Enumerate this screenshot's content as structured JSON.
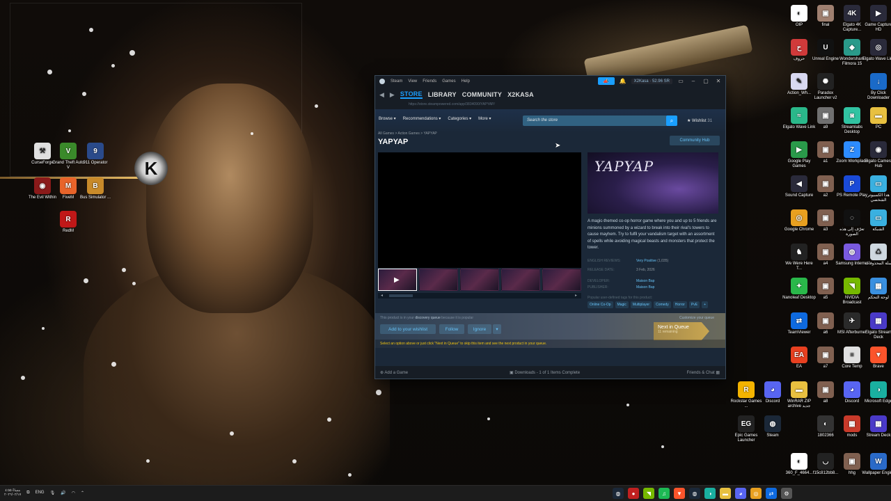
{
  "desktop": {
    "left_icons": [
      {
        "label": "CurseForge",
        "icon": "curseforge-icon",
        "color": "#e0e0e0",
        "glyph": "⚒"
      },
      {
        "label": "Grand Theft Auto V",
        "icon": "gta-icon",
        "color": "#3a8a2a",
        "glyph": "V"
      },
      {
        "label": "911 Operator",
        "icon": "operator-icon",
        "color": "#2a4a8a",
        "glyph": "9"
      },
      {
        "label": "The Evil Within",
        "icon": "evil-within-icon",
        "color": "#8a1a1a",
        "glyph": "◉"
      },
      {
        "label": "FiveM",
        "icon": "fivem-icon",
        "color": "#e8642a",
        "glyph": "M"
      },
      {
        "label": "Bus Simulator ...",
        "icon": "bus-icon",
        "color": "#c88a2a",
        "glyph": "B"
      },
      {
        "label": "RedM",
        "icon": "redm-icon",
        "color": "#c01818",
        "glyph": "R"
      }
    ],
    "right_icons": [
      {
        "label": "OIP",
        "icon": "oip-icon",
        "color": "#ffffff",
        "glyph": "◐"
      },
      {
        "label": "final",
        "icon": "image-icon",
        "color": "#a08070",
        "glyph": "▣"
      },
      {
        "label": "Elgato 4K Capture...",
        "icon": "elgato-4k-icon",
        "color": "#2a2a3a",
        "glyph": "4K"
      },
      {
        "label": "Game Capture HD",
        "icon": "game-capture-icon",
        "color": "#2a2a3a",
        "glyph": "▶"
      },
      {
        "label": "حروف",
        "icon": "letters-icon",
        "color": "#d03a3a",
        "glyph": "ح"
      },
      {
        "label": "Unreal Engine",
        "icon": "unreal-icon",
        "color": "#111111",
        "glyph": "U"
      },
      {
        "label": "Wondershare Filmora 15",
        "icon": "filmora-icon",
        "color": "#2a9a8a",
        "glyph": "◆"
      },
      {
        "label": "Elgato Wave Link",
        "icon": "wave-link-icon",
        "color": "#2a2a3a",
        "glyph": "◎"
      },
      {
        "label": "Action_Wh...",
        "icon": "file-icon",
        "color": "#d8d8f0",
        "glyph": "✎"
      },
      {
        "label": "Paradox Launcher v2",
        "icon": "paradox-icon",
        "color": "#222222",
        "glyph": "✺"
      },
      {
        "label": "By Click Downloader",
        "icon": "byclick-icon",
        "color": "#1a6ac8",
        "glyph": "↓"
      },
      {
        "label": "Elgato Wave Link",
        "icon": "wave-link-icon",
        "color": "#2ab88a",
        "glyph": "≈"
      },
      {
        "label": "a9",
        "icon": "image-icon",
        "color": "#707070",
        "glyph": "▣"
      },
      {
        "label": "Streamlabs Desktop",
        "icon": "streamlabs-icon",
        "color": "#31c3a2",
        "glyph": "◙"
      },
      {
        "label": "PC",
        "icon": "folder-icon",
        "color": "#e8c040",
        "glyph": "▬"
      },
      {
        "label": "Google Play Games",
        "icon": "play-games-icon",
        "color": "#2a9a4a",
        "glyph": "▶"
      },
      {
        "label": "a1",
        "icon": "image-icon",
        "color": "#806050",
        "glyph": "▣"
      },
      {
        "label": "Zoom Workplace",
        "icon": "zoom-icon",
        "color": "#2d8cff",
        "glyph": "Z"
      },
      {
        "label": "Elgato Camera Hub",
        "icon": "camera-hub-icon",
        "color": "#2a2a3a",
        "glyph": "◉"
      },
      {
        "label": "Sound Capture",
        "icon": "sound-capture-icon",
        "color": "#2a2a3a",
        "glyph": "◀"
      },
      {
        "label": "a2",
        "icon": "image-icon",
        "color": "#806050",
        "glyph": "▣"
      },
      {
        "label": "PS Remote Play",
        "icon": "ps-remote-icon",
        "color": "#1a4ad8",
        "glyph": "P"
      },
      {
        "label": "هذا الكمبيوتر الشخصي",
        "icon": "this-pc-icon",
        "color": "#3ab0e0",
        "glyph": "▭"
      },
      {
        "label": "Google Chrome",
        "icon": "chrome-icon",
        "color": "#e8a020",
        "glyph": "◎"
      },
      {
        "label": "a3",
        "icon": "image-icon",
        "color": "#806050",
        "glyph": "▣"
      },
      {
        "label": "تعرّف إلى هذه الصورة",
        "icon": "learn-icon",
        "color": "#111111",
        "glyph": "◌"
      },
      {
        "label": "الشبكة",
        "icon": "network-icon",
        "color": "#3ab0e0",
        "glyph": "▭"
      },
      {
        "label": "We Were Here T...",
        "icon": "we-were-here-icon",
        "color": "#222222",
        "glyph": "♞"
      },
      {
        "label": "a4",
        "icon": "image-icon",
        "color": "#806050",
        "glyph": "▣"
      },
      {
        "label": "Samsung Internet",
        "icon": "samsung-internet-icon",
        "color": "#7a5ae0",
        "glyph": "◍"
      },
      {
        "label": "سلة المحذوفات",
        "icon": "recycle-bin-icon",
        "color": "#cfd8e0",
        "glyph": "♺"
      },
      {
        "label": "Nanoleaf Desktop",
        "icon": "nanoleaf-icon",
        "color": "#2ab84a",
        "glyph": "✦"
      },
      {
        "label": "a5",
        "icon": "image-icon",
        "color": "#806050",
        "glyph": "▣"
      },
      {
        "label": "NVIDIA Broadcast",
        "icon": "nvidia-icon",
        "color": "#76b900",
        "glyph": "◥"
      },
      {
        "label": "لوحة التحكم",
        "icon": "control-panel-icon",
        "color": "#3a90e0",
        "glyph": "▦"
      },
      {
        "label": "TeamViewer",
        "icon": "teamviewer-icon",
        "color": "#0e6ae0",
        "glyph": "⇄"
      },
      {
        "label": "a6",
        "icon": "image-icon",
        "color": "#806050",
        "glyph": "▣"
      },
      {
        "label": "MSI Afterburner",
        "icon": "afterburner-icon",
        "color": "#2a2a2a",
        "glyph": "✈"
      },
      {
        "label": "Elgato Stream Deck",
        "icon": "stream-deck-icon",
        "color": "#4a3ac8",
        "glyph": "▦"
      },
      {
        "label": "EA",
        "icon": "ea-icon",
        "color": "#e84020",
        "glyph": "EA"
      },
      {
        "label": "a7",
        "icon": "image-icon",
        "color": "#806050",
        "glyph": "▣"
      },
      {
        "label": "Core Temp",
        "icon": "core-temp-icon",
        "color": "#e0e0e0",
        "glyph": "≡"
      },
      {
        "label": "Brave",
        "icon": "brave-icon",
        "color": "#fb542b",
        "glyph": "▼"
      },
      {
        "label": "Rockstar Games ...",
        "icon": "rockstar-icon",
        "color": "#f4b400",
        "glyph": "R"
      },
      {
        "label": "Discord",
        "icon": "discord-icon",
        "color": "#5865f2",
        "glyph": "◕"
      },
      {
        "label": "WinRAR ZIP archive جديد",
        "icon": "winrar-icon",
        "color": "#e8c040",
        "glyph": "▬"
      },
      {
        "label": "a8",
        "icon": "image-icon",
        "color": "#806050",
        "glyph": "▣"
      },
      {
        "label": "Discord",
        "icon": "discord-icon",
        "color": "#5865f2",
        "glyph": "◕"
      },
      {
        "label": "Microsoft Edge",
        "icon": "edge-icon",
        "color": "#1ab0a0",
        "glyph": "◑"
      },
      {
        "label": "Epic Games Launcher",
        "icon": "epic-icon",
        "color": "#222222",
        "glyph": "EG"
      },
      {
        "label": "Steam",
        "icon": "steam-icon",
        "color": "#1b2838",
        "glyph": "◍"
      },
      {
        "label": "1802366",
        "icon": "image-icon",
        "color": "#333333",
        "glyph": "◐"
      },
      {
        "label": "mods",
        "icon": "mods-icon",
        "color": "#c83a2a",
        "glyph": "▦"
      },
      {
        "label": "Stream Deck",
        "icon": "stream-deck-icon",
        "color": "#4a3ac8",
        "glyph": "▦"
      },
      {
        "label": "360_F_4664...",
        "icon": "image-icon",
        "color": "#ffffff",
        "glyph": "◐"
      },
      {
        "label": "f15c812bb8...",
        "icon": "image-icon",
        "color": "#222222",
        "glyph": "◡"
      },
      {
        "label": "hhg",
        "icon": "image-icon",
        "color": "#806050",
        "glyph": "▣"
      },
      {
        "label": "Wallpaper Engine",
        "icon": "wallpaper-engine-icon",
        "color": "#2a6ac8",
        "glyph": "W"
      }
    ]
  },
  "steam": {
    "titlebar": {
      "menu": [
        "Steam",
        "View",
        "Friends",
        "Games",
        "Help"
      ],
      "account": "X2Kasa",
      "balance": "52.96 SR"
    },
    "nav": {
      "tabs": [
        "STORE",
        "LIBRARY",
        "COMMUNITY",
        "X2KASA"
      ],
      "url": "https://store.steampowered.com/app/3834090/YAPYAP/"
    },
    "store_menu": [
      "Browse",
      "Recommendations",
      "Categories",
      "More"
    ],
    "search_placeholder": "Search the store",
    "wishlist": {
      "label": "Wishlist",
      "count": "31"
    },
    "breadcrumb": "All Games > Action Games > YAPYAP",
    "title": "YAPYAP",
    "community_hub": "Community Hub",
    "capsule_logo": "YAPYAP",
    "description": "A magic-themed co-op horror game where you and up to 5 friends are minions summoned by a wizard to break into their rival's towers to cause mayhem. Try to fulfil your vandalism target with an assortment of spells while avoiding magical beasts and monsters that protect the tower.",
    "meta": {
      "reviews_label": "ENGLISH REVIEWS:",
      "reviews_value": "Very Positive",
      "reviews_count": "(1,035)",
      "release_label": "RELEASE DATE:",
      "release_value": "3 Feb, 2026",
      "developer_label": "DEVELOPER:",
      "developer_value": "Maison Bap",
      "publisher_label": "PUBLISHER:",
      "publisher_value": "Maison Bap"
    },
    "tags_label": "Popular user-defined tags for this product:",
    "tags": [
      "Online Co-Op",
      "Magic",
      "Multiplayer",
      "Comedy",
      "Horror",
      "PvE",
      "+"
    ],
    "queue": {
      "note_pre": "This product is in your",
      "note_link": "discovery queue",
      "note_post": "because it is popular",
      "customize": "Customize your queue",
      "add_wishlist": "Add to your wishlist",
      "follow": "Follow",
      "ignore": "Ignore",
      "next_label": "Next in Queue",
      "next_sub": "11 remaining",
      "hint": "Select an option above or just click \"Next in Queue\" to skip this item and see the next product in your queue."
    },
    "bottom": {
      "add_game": "Add a Game",
      "downloads": "Downloads - 1 of 1 Items Complete",
      "friends": "Friends & Chat"
    }
  },
  "taskbar": {
    "time": "مساءً ٤:٥٥",
    "date": "٢٠٢٦/٠٢/١٧",
    "lang": "ENG",
    "icons": [
      "steam-icon",
      "record-icon",
      "nvidia-icon",
      "spotify-icon",
      "brave-icon",
      "steam-icon",
      "edge-icon",
      "explorer-icon",
      "discord-icon",
      "chrome-icon",
      "teamviewer-icon",
      "settings-icon"
    ]
  },
  "colors": {
    "steam_bg": "#1b2838",
    "steam_accent": "#1a9fff",
    "link": "#66c0f4"
  }
}
